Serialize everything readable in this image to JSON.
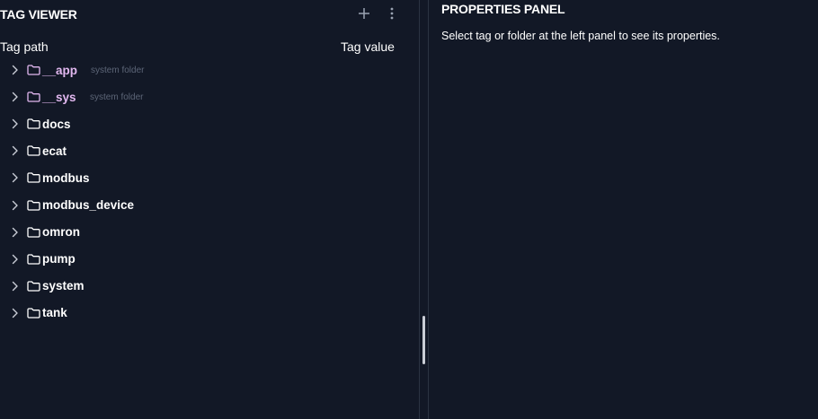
{
  "tag_viewer": {
    "title": "TAG VIEWER",
    "add_icon": "plus-icon",
    "more_icon": "vertical-dots-icon",
    "columns": {
      "path": "Tag path",
      "value": "Tag value"
    },
    "items": [
      {
        "label": "__app",
        "sub": "system folder",
        "system": true
      },
      {
        "label": "__sys",
        "sub": "system folder",
        "system": true
      },
      {
        "label": "docs",
        "sub": "",
        "system": false
      },
      {
        "label": "ecat",
        "sub": "",
        "system": false
      },
      {
        "label": "modbus",
        "sub": "",
        "system": false
      },
      {
        "label": "modbus_device",
        "sub": "",
        "system": false
      },
      {
        "label": "omron",
        "sub": "",
        "system": false
      },
      {
        "label": "pump",
        "sub": "",
        "system": false
      },
      {
        "label": "system",
        "sub": "",
        "system": false
      },
      {
        "label": "tank",
        "sub": "",
        "system": false
      }
    ]
  },
  "properties_panel": {
    "title": "PROPERTIES PANEL",
    "message": "Select tag or folder at the left panel to see its properties."
  },
  "colors": {
    "background": "#121826",
    "text": "#ffffff",
    "system_folder_label": "#e2b8f0",
    "muted": "#5c6577",
    "divider": "#2b3342"
  }
}
